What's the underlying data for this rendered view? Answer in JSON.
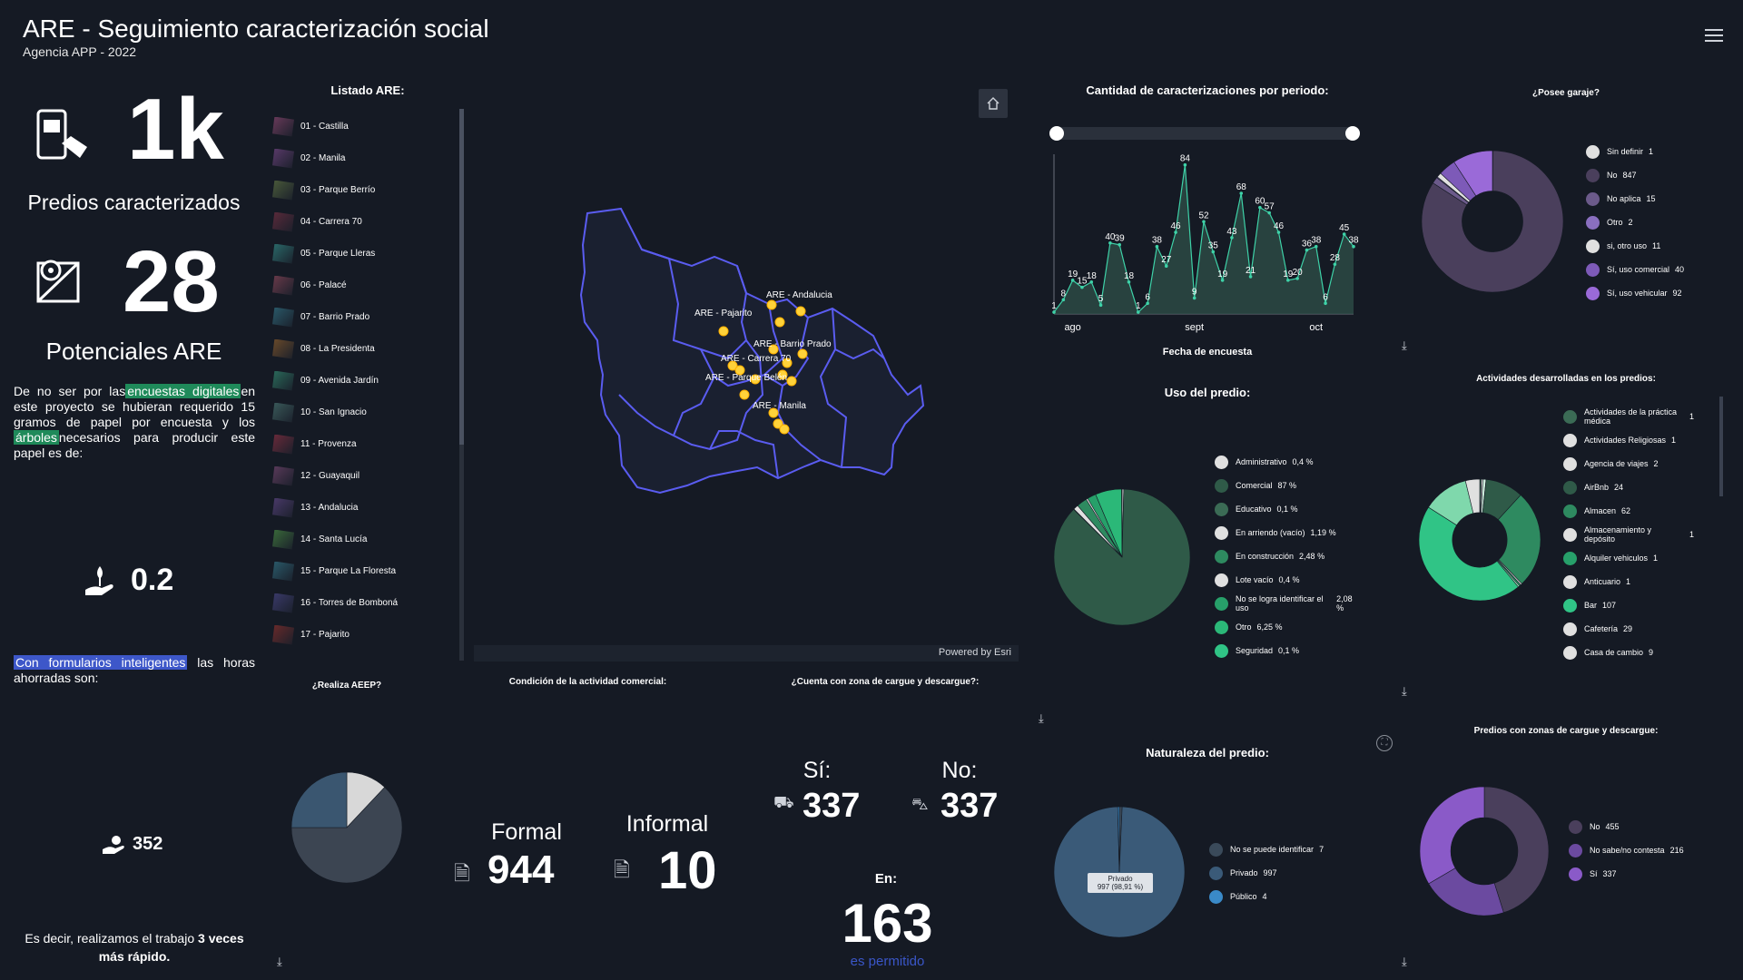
{
  "header": {
    "title": "ARE - Seguimiento caracterización social",
    "subtitle": "Agencia APP - 2022"
  },
  "left": {
    "stat1": {
      "value": "1k",
      "label": "Predios caracterizados"
    },
    "stat2": {
      "value": "28",
      "label": "Potenciales ARE"
    },
    "para1": {
      "a": "De no ser por las",
      "hl1": "encuestas digitales",
      "b": "en este proyecto se hubieran requerido 15 gramos de papel por encuesta y los",
      "hl2": "árboles",
      "c": "necesarios para producir este papel es de:"
    },
    "trees_value": "0.2",
    "para2": {
      "hl": "Con formularios inteligentes",
      "rest": "las horas ahorradas son:"
    },
    "hours_value": "352",
    "closing": {
      "a": "Es decir, realizamos el trabajo",
      "b": "3 veces más rápido."
    }
  },
  "listado": {
    "title": "Listado ARE:",
    "items": [
      {
        "label": "01 - Castilla",
        "color": "#6a3a5a"
      },
      {
        "label": "02 - Manila",
        "color": "#5a3a6a"
      },
      {
        "label": "03 - Parque Berrío",
        "color": "#4a5a3a"
      },
      {
        "label": "04 - Carrera 70",
        "color": "#5a2a3a"
      },
      {
        "label": "05 - Parque Lleras",
        "color": "#2a6a6a"
      },
      {
        "label": "06 - Palacé",
        "color": "#6a3a4a"
      },
      {
        "label": "07 - Barrio Prado",
        "color": "#2a5a6a"
      },
      {
        "label": "08 - La Presidenta",
        "color": "#6a4a2a"
      },
      {
        "label": "09 - Avenida Jardín",
        "color": "#2a6a5a"
      },
      {
        "label": "10 - San Ignacio",
        "color": "#3a5a5a"
      },
      {
        "label": "11 - Provenza",
        "color": "#6a2a3a"
      },
      {
        "label": "12 - Guayaquil",
        "color": "#5a3a5a"
      },
      {
        "label": "13 - Andalucia",
        "color": "#4a3a6a"
      },
      {
        "label": "14 - Santa Lucía",
        "color": "#3a6a3a"
      },
      {
        "label": "15 - Parque La Floresta",
        "color": "#2a5a6a"
      },
      {
        "label": "16 - Torres de Bomboná",
        "color": "#3a3a6a"
      },
      {
        "label": "17 - Pajarito",
        "color": "#6a2a2a"
      }
    ]
  },
  "map": {
    "attribution": "Powered by Esri",
    "labels": [
      "ARE - Andalucia",
      "ARE - Pajarito",
      "ARE - Barrio Prado",
      "ARE - Carrera 70",
      "ARE - Parque Belén",
      "ARE - Manila"
    ]
  },
  "line_chart_panel": {
    "title": "Cantidad de caracterizaciones por periodo:",
    "xlabel": "Fecha de encuesta"
  },
  "garaje": {
    "title": "¿Posee garaje?",
    "legend": [
      {
        "label": "Sin definir",
        "value": "1",
        "color": "#e0e0e0"
      },
      {
        "label": "No",
        "value": "847",
        "color": "#4a3f5c"
      },
      {
        "label": "No aplica",
        "value": "15",
        "color": "#6b5a8a"
      },
      {
        "label": "Otro",
        "value": "2",
        "color": "#8a6fc0"
      },
      {
        "label": "si, otro uso",
        "value": "11",
        "color": "#e0e0e0"
      },
      {
        "label": "Sí, uso comercial",
        "value": "40",
        "color": "#7d5ab8"
      },
      {
        "label": "Sí, uso vehicular",
        "value": "92",
        "color": "#9a6ad8"
      }
    ]
  },
  "uso": {
    "title": "Uso del predio:",
    "legend": [
      {
        "label": "Administrativo",
        "value": "0,4 %",
        "color": "#e0e0e0"
      },
      {
        "label": "Comercial",
        "value": "87 %",
        "color": "#2f5a48"
      },
      {
        "label": "Educativo",
        "value": "0,1 %",
        "color": "#3b6b55"
      },
      {
        "label": "En arriendo (vacío)",
        "value": "1,19 %",
        "color": "#e0e0e0"
      },
      {
        "label": "En construcción",
        "value": "2,48 %",
        "color": "#2e8a60"
      },
      {
        "label": "Lote vacío",
        "value": "0,4 %",
        "color": "#e0e0e0"
      },
      {
        "label": "No se logra identificar el uso",
        "value": "2,08 %",
        "color": "#27a06a"
      },
      {
        "label": "Otro",
        "value": "6,25 %",
        "color": "#2bb878"
      },
      {
        "label": "Seguridad",
        "value": "0,1 %",
        "color": "#30c486"
      }
    ]
  },
  "actividades": {
    "title": "Actividades desarrolladas en los predios:",
    "legend": [
      {
        "label": "Actividades de la práctica médica",
        "value": "1",
        "color": "#3b6b55"
      },
      {
        "label": "Actividades Religiosas",
        "value": "1",
        "color": "#e0e0e0"
      },
      {
        "label": "Agencia de viajes",
        "value": "2",
        "color": "#e0e0e0"
      },
      {
        "label": "AirBnb",
        "value": "24",
        "color": "#2f5a48"
      },
      {
        "label": "Almacen",
        "value": "62",
        "color": "#2e8a60"
      },
      {
        "label": "Almacenamiento y depósito",
        "value": "1",
        "color": "#e0e0e0"
      },
      {
        "label": "Alquiler vehiculos",
        "value": "1",
        "color": "#27a06a"
      },
      {
        "label": "Anticuario",
        "value": "1",
        "color": "#e0e0e0"
      },
      {
        "label": "Bar",
        "value": "107",
        "color": "#30c486"
      },
      {
        "label": "Cafetería",
        "value": "29",
        "color": "#e0e0e0"
      },
      {
        "label": "Casa de cambio",
        "value": "9",
        "color": "#e0e0e0"
      }
    ]
  },
  "aeep": {
    "title": "¿Realiza AEEP?"
  },
  "condicion": {
    "title": "Condición de la actividad comercial:",
    "formal_label": "Formal",
    "formal_value": "944",
    "informal_label": "Informal",
    "informal_value": "10"
  },
  "zona": {
    "title": "¿Cuenta con zona de cargue y descargue?:",
    "si_label": "Sí:",
    "si_value": "337",
    "no_label": "No:",
    "no_value": "337",
    "en_label": "En:",
    "en_value": "163",
    "en_sub": "es permitido"
  },
  "naturaleza": {
    "title": "Naturaleza del predio:",
    "tooltip_a": "Privado",
    "tooltip_b": "997 (98,91 %)",
    "legend": [
      {
        "label": "No se puede identificar",
        "value": "7",
        "color": "#3a4a5a"
      },
      {
        "label": "Privado",
        "value": "997",
        "color": "#3a5a78"
      },
      {
        "label": "Público",
        "value": "4",
        "color": "#3a8ac8"
      }
    ]
  },
  "cargue": {
    "title": "Predios con zonas de cargue y descargue:",
    "legend": [
      {
        "label": "No",
        "value": "455",
        "color": "#4a3f5c"
      },
      {
        "label": "No sabe/no contesta",
        "value": "216",
        "color": "#6b4aa0"
      },
      {
        "label": "Sí",
        "value": "337",
        "color": "#8a5ac8"
      }
    ]
  },
  "chart_data": [
    {
      "type": "area",
      "title": "Cantidad de caracterizaciones por periodo:",
      "xlabel": "Fecha de encuesta",
      "ylabel": "",
      "x_ticks": [
        "ago",
        "sept",
        "oct"
      ],
      "values": [
        1,
        8,
        19,
        15,
        18,
        5,
        40,
        39,
        18,
        1,
        6,
        38,
        27,
        46,
        84,
        9,
        52,
        35,
        19,
        43,
        68,
        21,
        60,
        57,
        46,
        19,
        20,
        36,
        38,
        6,
        28,
        45,
        38
      ]
    },
    {
      "type": "pie",
      "title": "¿Posee garaje?",
      "categories": [
        "Sin definir",
        "No",
        "No aplica",
        "Otro",
        "si, otro uso",
        "Sí, uso comercial",
        "Sí, uso vehicular"
      ],
      "values": [
        1,
        847,
        15,
        2,
        11,
        40,
        92
      ]
    },
    {
      "type": "pie",
      "title": "Uso del predio:",
      "categories": [
        "Administrativo",
        "Comercial",
        "Educativo",
        "En arriendo (vacío)",
        "En construcción",
        "Lote vacío",
        "No se logra identificar el uso",
        "Otro",
        "Seguridad"
      ],
      "values": [
        0.4,
        87,
        0.1,
        1.19,
        2.48,
        0.4,
        2.08,
        6.25,
        0.1
      ]
    },
    {
      "type": "pie",
      "title": "Actividades desarrolladas en los predios:",
      "categories": [
        "Actividades de la práctica médica",
        "Actividades Religiosas",
        "Agencia de viajes",
        "AirBnb",
        "Almacen",
        "Almacenamiento y depósito",
        "Alquiler vehiculos",
        "Anticuario",
        "Bar",
        "Cafetería",
        "Casa de cambio"
      ],
      "values": [
        1,
        1,
        2,
        24,
        62,
        1,
        1,
        1,
        107,
        29,
        9
      ]
    },
    {
      "type": "pie",
      "title": "¿Realiza AEEP?",
      "categories": [],
      "values": [
        12,
        63,
        25
      ]
    },
    {
      "type": "pie",
      "title": "Naturaleza del predio:",
      "categories": [
        "No se puede identificar",
        "Privado",
        "Público"
      ],
      "values": [
        7,
        997,
        4
      ]
    },
    {
      "type": "pie",
      "title": "Predios con zonas de cargue y descargue:",
      "categories": [
        "No",
        "No sabe/no contesta",
        "Sí"
      ],
      "values": [
        455,
        216,
        337
      ]
    }
  ]
}
